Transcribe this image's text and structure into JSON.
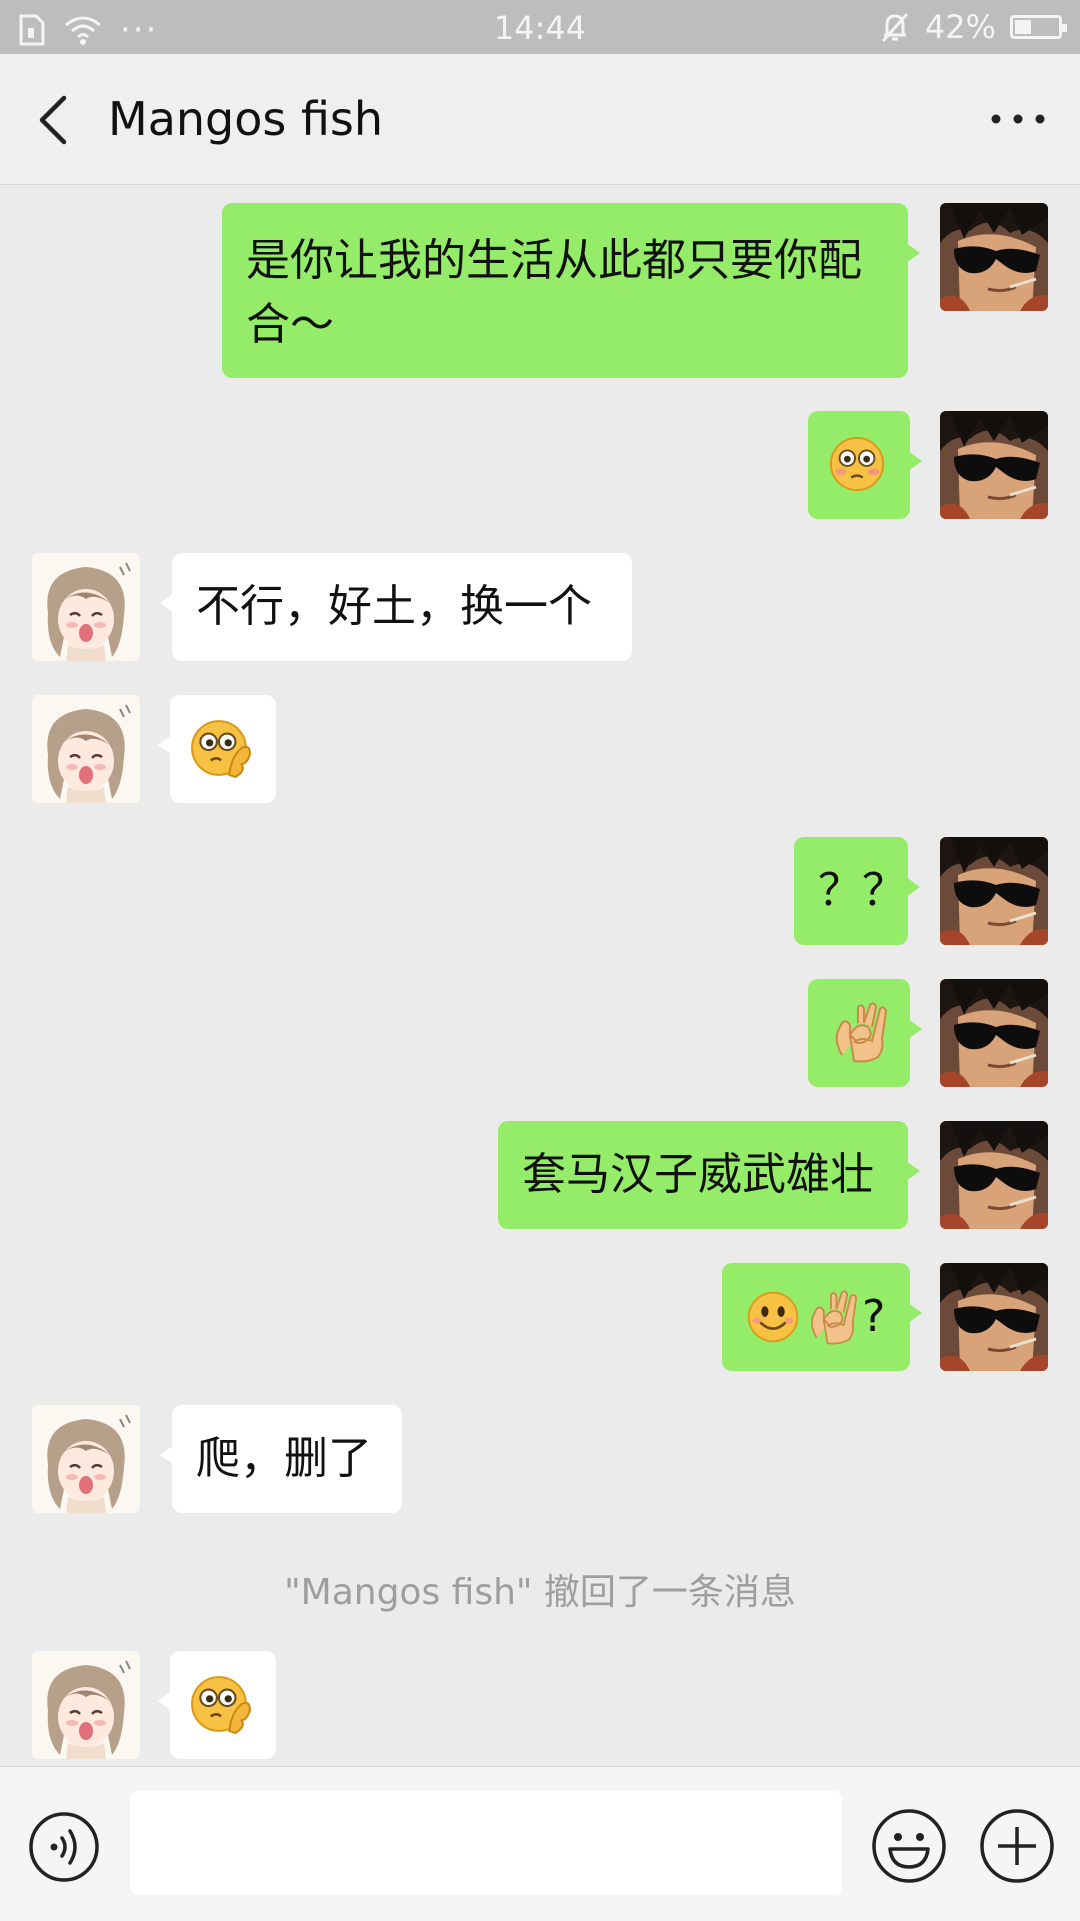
{
  "status_bar": {
    "time": "14:44",
    "battery": "42%",
    "more_dots": "···",
    "icons": [
      "sim-icon",
      "wifi-icon",
      "mute-bell-icon",
      "battery-icon"
    ]
  },
  "header": {
    "title": "Mangos fish",
    "back_icon": "chevron-left-icon",
    "more_icon": "more-dots-icon"
  },
  "messages": [
    {
      "from": "self",
      "type": "text",
      "lines": [
        "是你让我的生活从此都只要你配",
        "合～"
      ]
    },
    {
      "from": "self",
      "type": "emoji",
      "icons": [
        "flushed-face-emoji"
      ]
    },
    {
      "from": "other",
      "type": "text",
      "lines": [
        "不行，好土，换一个"
      ]
    },
    {
      "from": "other",
      "type": "emoji",
      "icons": [
        "thinking-face-emoji"
      ]
    },
    {
      "from": "self",
      "type": "text",
      "lines": [
        "？？"
      ]
    },
    {
      "from": "self",
      "type": "emoji",
      "icons": [
        "ok-hand-emoji"
      ]
    },
    {
      "from": "self",
      "type": "text",
      "lines": [
        "套马汉子威武雄壮"
      ]
    },
    {
      "from": "self",
      "type": "mixed",
      "icons": [
        "smile-face-emoji",
        "ok-hand-emoji"
      ],
      "text": "?"
    },
    {
      "from": "other",
      "type": "text",
      "lines": [
        "爬，删了"
      ]
    },
    {
      "from": "system",
      "type": "notice",
      "text": "\"Mangos fish\" 撤回了一条消息"
    },
    {
      "from": "other",
      "type": "emoji",
      "icons": [
        "thinking-face-emoji"
      ]
    }
  ],
  "input_bar": {
    "placeholder": "",
    "value": "",
    "icons": [
      "voice-icon",
      "emoji-icon",
      "plus-icon"
    ]
  },
  "colors": {
    "self_bubble": "#95ec69",
    "other_bubble": "#ffffff",
    "chat_background": "#ebebeb",
    "status_bar": "#bdbdbd"
  }
}
